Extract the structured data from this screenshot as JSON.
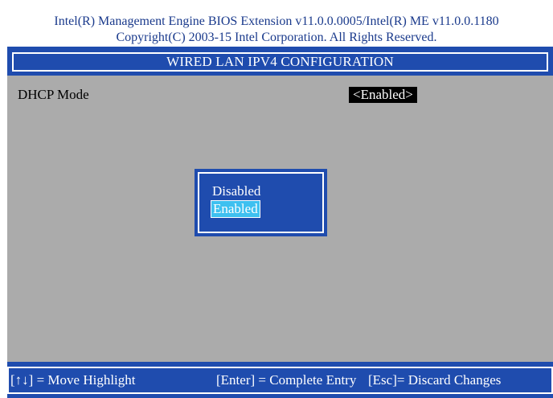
{
  "header": {
    "line1": "Intel(R) Management Engine BIOS Extension v11.0.0.0005/Intel(R) ME v11.0.0.1180",
    "line2": "Copyright(C) 2003-15 Intel Corporation. All Rights Reserved."
  },
  "page_title": "WIRED LAN IPV4 CONFIGURATION",
  "settings": [
    {
      "label": "DHCP Mode",
      "value": "<Enabled>"
    }
  ],
  "popup": {
    "options": [
      "Disabled",
      "Enabled"
    ],
    "selected": "Enabled"
  },
  "footer": {
    "hints": [
      "[↑↓] = Move Highlight",
      "[Enter] = Complete Entry",
      "[Esc]= Discard Changes"
    ]
  },
  "colors": {
    "header_text": "#1a3a8c",
    "bar_blue": "#1f4cae",
    "panel_gray": "#ababab",
    "highlight_cyan": "#3ec0f0",
    "value_black": "#000000"
  }
}
